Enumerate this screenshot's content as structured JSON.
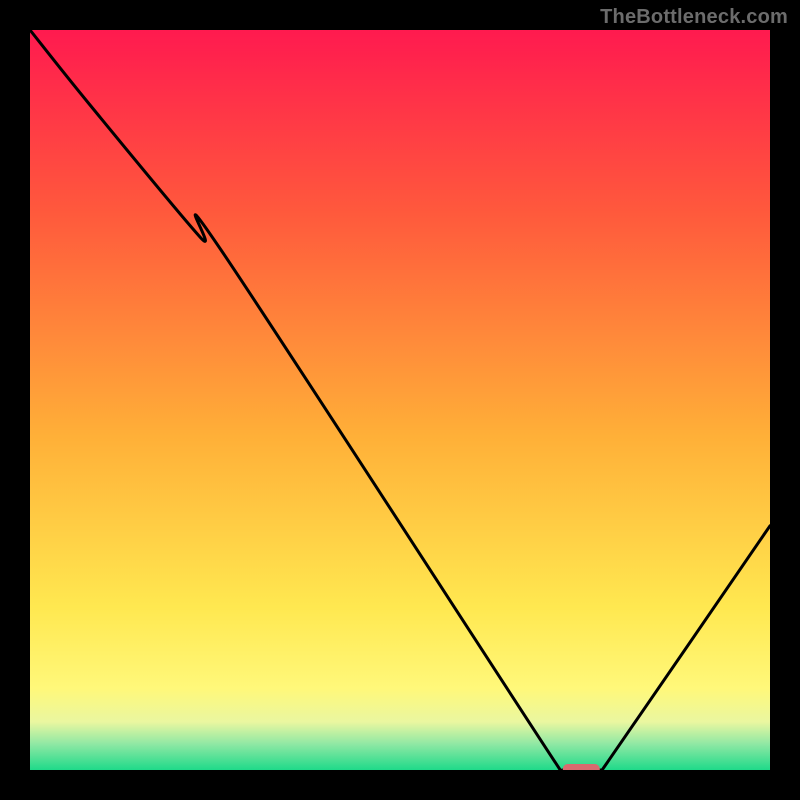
{
  "watermark": "TheBottleneck.com",
  "chart_data": {
    "type": "line",
    "title": "",
    "xlabel": "",
    "ylabel": "",
    "xlim": [
      0,
      100
    ],
    "ylim": [
      0,
      100
    ],
    "grid": false,
    "legend": false,
    "gradient_stops": [
      {
        "offset": 0.0,
        "color": "#ff1a4f"
      },
      {
        "offset": 0.25,
        "color": "#ff5a3c"
      },
      {
        "offset": 0.55,
        "color": "#ffb038"
      },
      {
        "offset": 0.78,
        "color": "#ffe850"
      },
      {
        "offset": 0.89,
        "color": "#fff87a"
      },
      {
        "offset": 0.935,
        "color": "#eaf7a0"
      },
      {
        "offset": 0.965,
        "color": "#8fe8a4"
      },
      {
        "offset": 1.0,
        "color": "#1fda8a"
      }
    ],
    "series": [
      {
        "name": "bottleneck-curve",
        "x": [
          0,
          8,
          23,
          26,
          71,
          72,
          77,
          78,
          100
        ],
        "values": [
          100,
          90,
          72,
          70,
          1,
          0,
          0,
          1,
          33
        ]
      }
    ],
    "marker": {
      "x_start": 72,
      "x_end": 77,
      "y": 0,
      "color": "#d96b6f"
    }
  }
}
